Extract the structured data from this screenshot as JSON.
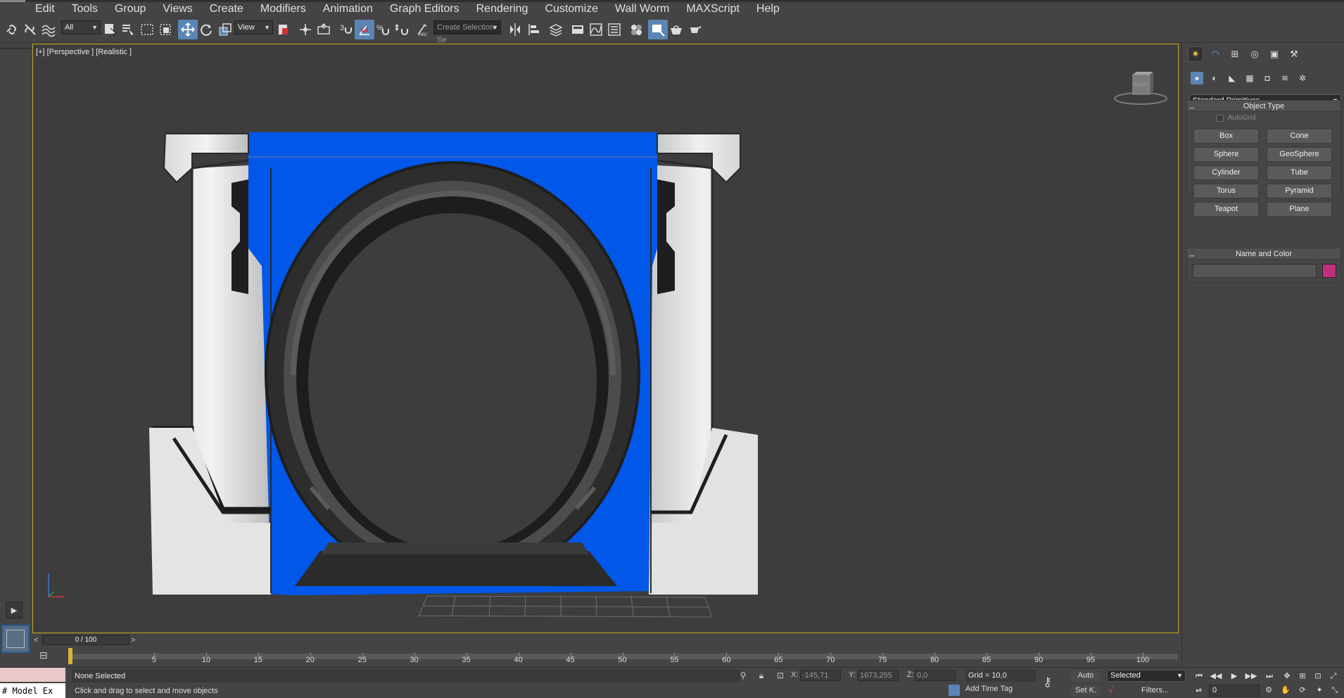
{
  "menu": [
    "Edit",
    "Tools",
    "Group",
    "Views",
    "Create",
    "Modifiers",
    "Animation",
    "Graph Editors",
    "Rendering",
    "Customize",
    "Wall Worm",
    "MAXScript",
    "Help"
  ],
  "toolbar": {
    "filter_value": "All",
    "refcoord_value": "View",
    "snap_label": "3",
    "named_selection_placeholder": "Create Selection Se",
    "icons": [
      "link-icon",
      "unlink-icon",
      "bind-spacewarp-icon",
      "select-object-icon",
      "select-by-name-icon",
      "rect-region-icon",
      "window-crossing-icon",
      "select-move-icon",
      "select-rotate-icon",
      "select-scale-icon",
      "pivot-icon",
      "select-manipulate-icon",
      "keyboard-shortcut-icon",
      "snap-toggle-icon",
      "angle-snap-icon",
      "percent-snap-icon",
      "spinner-snap-icon",
      "edit-named-sets-icon",
      "mirror-icon",
      "align-icon",
      "layer-explorer-icon",
      "scene-explorer-icon",
      "curve-editor-icon",
      "schematic-view-icon",
      "material-editor-icon",
      "render-setup-icon",
      "rendered-frame-icon",
      "render-icon"
    ]
  },
  "viewport": {
    "label": "[+] [Perspective ] [Realistic ]",
    "viewcube_label": "FRONT",
    "border_color": "#c9a71e",
    "accent_blue": "#0057e8"
  },
  "command_panel": {
    "tabs": [
      "create-tab-icon",
      "modify-tab-icon",
      "hierarchy-tab-icon",
      "motion-tab-icon",
      "display-tab-icon",
      "utilities-tab-icon"
    ],
    "categories": [
      "geometry-icon",
      "shapes-icon",
      "lights-icon",
      "cameras-icon",
      "helpers-icon",
      "spacewarps-icon",
      "systems-icon"
    ],
    "primitive_type": "Standard Primitives",
    "object_type": {
      "title": "Object Type",
      "autogrid_label": "AutoGrid",
      "buttons": [
        "Box",
        "Cone",
        "Sphere",
        "GeoSphere",
        "Cylinder",
        "Tube",
        "Torus",
        "Pyramid",
        "Teapot",
        "Plane"
      ]
    },
    "name_and_color": {
      "title": "Name and Color",
      "name_value": "",
      "color": "#c0307a"
    }
  },
  "timeline": {
    "frame_display": "0 / 100",
    "left_arrow": "<",
    "right_arrow": ">",
    "ticks": [
      "5",
      "10",
      "15",
      "20",
      "25",
      "30",
      "35",
      "40",
      "45",
      "50",
      "55",
      "60",
      "65",
      "70",
      "75",
      "80",
      "85",
      "90",
      "95",
      "100"
    ]
  },
  "status": {
    "maxscript_text": "# Model Ex",
    "selection": "None Selected",
    "prompt": "Click and drag to select and move objects",
    "x_label": "X:",
    "x_value": "-145,71",
    "y_label": "Y:",
    "y_value": "1673,255",
    "z_label": "Z:",
    "z_value": "0,0",
    "grid": "Grid = 10,0",
    "add_time_tag": "Add Time Tag",
    "auto_label": "Auto",
    "setk_label": "Set K.",
    "key_filter_value": "Selected",
    "filters_label": "Filters...",
    "current_frame": "0"
  }
}
